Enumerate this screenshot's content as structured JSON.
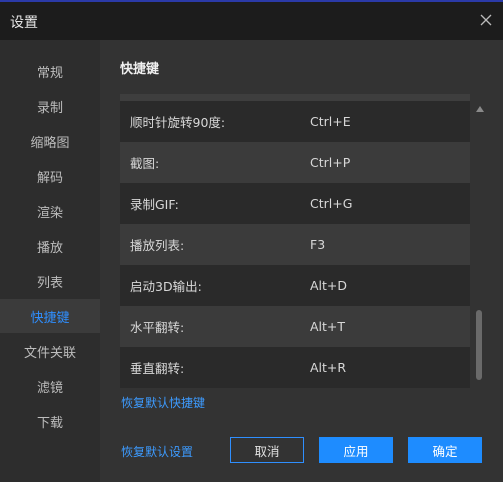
{
  "window": {
    "title": "设置"
  },
  "sidebar": {
    "items": [
      {
        "label": "常规"
      },
      {
        "label": "录制"
      },
      {
        "label": "缩略图"
      },
      {
        "label": "解码"
      },
      {
        "label": "渲染"
      },
      {
        "label": "播放"
      },
      {
        "label": "列表"
      },
      {
        "label": "快捷键"
      },
      {
        "label": "文件关联"
      },
      {
        "label": "滤镜"
      },
      {
        "label": "下载"
      }
    ],
    "active": "快捷键"
  },
  "main": {
    "section_title": "快捷键",
    "shortcuts": [
      {
        "name": "顺时针旋转90度:",
        "key": "Ctrl+E"
      },
      {
        "name": "截图:",
        "key": "Ctrl+P"
      },
      {
        "name": "录制GIF:",
        "key": "Ctrl+G"
      },
      {
        "name": "播放列表:",
        "key": "F3"
      },
      {
        "name": "启动3D输出:",
        "key": "Alt+D"
      },
      {
        "name": "水平翻转:",
        "key": "Alt+T"
      },
      {
        "name": "垂直翻转:",
        "key": "Alt+R"
      }
    ],
    "restore_shortcuts_link": "恢复默认快捷键"
  },
  "footer": {
    "restore_defaults_link": "恢复默认设置",
    "cancel_label": "取消",
    "apply_label": "应用",
    "ok_label": "确定"
  },
  "colors": {
    "accent": "#1e8cff",
    "active_text": "#2f8fff"
  },
  "icons": {
    "close": "close-icon",
    "scroll_up": "scroll-up-arrow-icon"
  }
}
